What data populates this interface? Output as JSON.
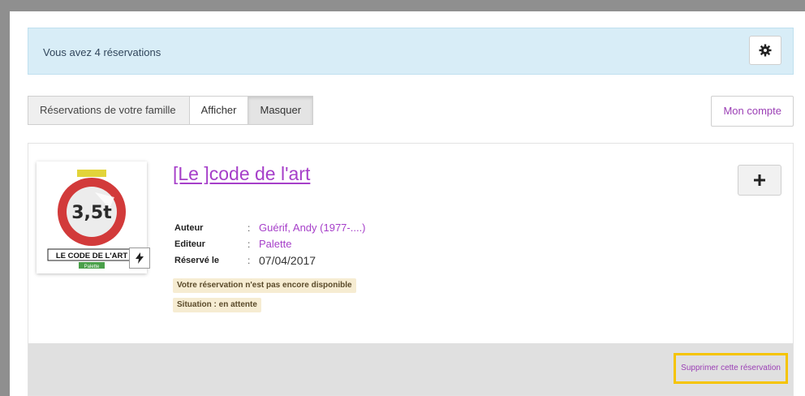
{
  "banner": {
    "text": "Vous avez 4 réservations",
    "settings_icon": "gear-icon"
  },
  "family": {
    "label": "Réservations de votre famille",
    "show_label": "Afficher",
    "hide_label": "Masquer",
    "active": "Masquer"
  },
  "account": {
    "label": "Mon compte"
  },
  "reservation": {
    "title": "[Le ]code de l'art",
    "cover": {
      "top_label": "LE CODE DE L'ART",
      "sign_text": "3,5t",
      "publisher_badge": "Palette"
    },
    "fields": [
      {
        "key": "Auteur",
        "value": "Guérif, Andy (1977-....)"
      },
      {
        "key": "Editeur",
        "value": "Palette"
      },
      {
        "key": "Réservé le",
        "value": "07/04/2017"
      }
    ],
    "status_tags": [
      "Votre réservation n'est pas encore disponible",
      "Situation : en attente"
    ],
    "delete_label": "Supprimer cette réservation",
    "expand_icon": "plus-icon",
    "flash_icon": "lightning-icon"
  },
  "colors": {
    "accent": "#a63fc9",
    "banner_bg": "#d8edf7",
    "highlight": "#f5c400",
    "tag_bg": "#f6ecd2"
  }
}
